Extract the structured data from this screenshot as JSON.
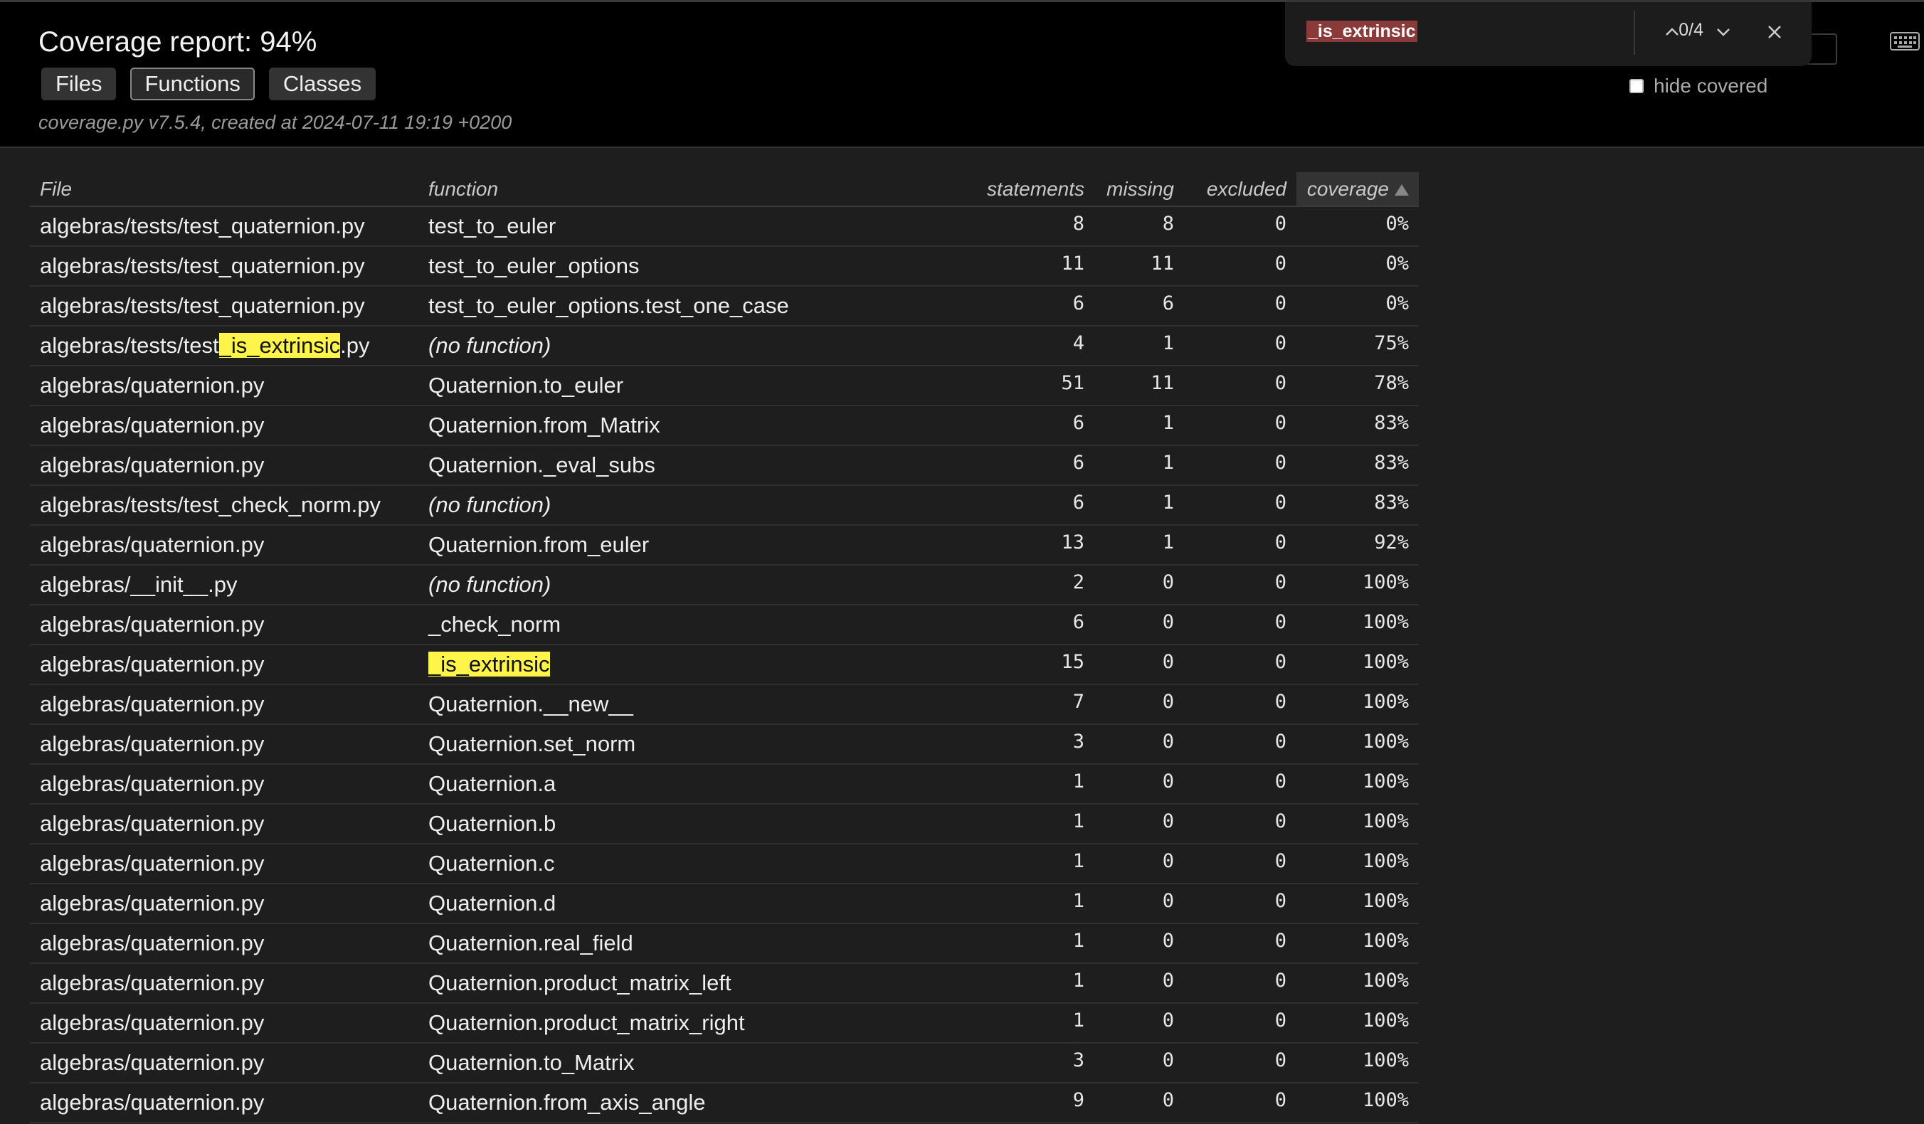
{
  "header": {
    "title": "Coverage report: 94%",
    "tabs": [
      {
        "label": "Files",
        "active": false
      },
      {
        "label": "Functions",
        "active": true
      },
      {
        "label": "Classes",
        "active": false
      }
    ],
    "meta": "coverage.py v7.5.4, created at 2024-07-11 19:19 +0200",
    "hide_covered_label": "hide covered",
    "hide_covered_checked": false
  },
  "find_bar": {
    "query": "_is_extrinsic",
    "count": "0/4",
    "icons": [
      "chevron-up-icon",
      "chevron-down-icon",
      "close-icon"
    ],
    "highlight_color": "#fff44a"
  },
  "table": {
    "columns": [
      "File",
      "function",
      "statements",
      "missing",
      "excluded",
      "coverage"
    ],
    "sorted_column": "coverage",
    "rows": [
      {
        "file": "algebras/tests/test_quaternion.py",
        "function": "test_to_euler",
        "statements": "8",
        "missing": "8",
        "excluded": "0",
        "coverage": "0%"
      },
      {
        "file": "algebras/tests/test_quaternion.py",
        "function": "test_to_euler_options",
        "statements": "11",
        "missing": "11",
        "excluded": "0",
        "coverage": "0%"
      },
      {
        "file": "algebras/tests/test_quaternion.py",
        "function": "test_to_euler_options.test_one_case",
        "statements": "6",
        "missing": "6",
        "excluded": "0",
        "coverage": "0%"
      },
      {
        "file": "algebras/tests/test_is_extrinsic.py",
        "file_parts": [
          "algebras/tests/test",
          "_is_extrinsic",
          ".py"
        ],
        "function": "(no function)",
        "statements": "4",
        "missing": "1",
        "excluded": "0",
        "coverage": "75%"
      },
      {
        "file": "algebras/quaternion.py",
        "function": "Quaternion.to_euler",
        "statements": "51",
        "missing": "11",
        "excluded": "0",
        "coverage": "78%"
      },
      {
        "file": "algebras/quaternion.py",
        "function": "Quaternion.from_Matrix",
        "statements": "6",
        "missing": "1",
        "excluded": "0",
        "coverage": "83%"
      },
      {
        "file": "algebras/quaternion.py",
        "function": "Quaternion._eval_subs",
        "statements": "6",
        "missing": "1",
        "excluded": "0",
        "coverage": "83%"
      },
      {
        "file": "algebras/tests/test_check_norm.py",
        "function": "(no function)",
        "statements": "6",
        "missing": "1",
        "excluded": "0",
        "coverage": "83%"
      },
      {
        "file": "algebras/quaternion.py",
        "function": "Quaternion.from_euler",
        "statements": "13",
        "missing": "1",
        "excluded": "0",
        "coverage": "92%"
      },
      {
        "file": "algebras/__init__.py",
        "function": "(no function)",
        "statements": "2",
        "missing": "0",
        "excluded": "0",
        "coverage": "100%"
      },
      {
        "file": "algebras/quaternion.py",
        "function": "_check_norm",
        "statements": "6",
        "missing": "0",
        "excluded": "0",
        "coverage": "100%"
      },
      {
        "file": "algebras/quaternion.py",
        "function": "_is_extrinsic",
        "function_highlight": true,
        "statements": "15",
        "missing": "0",
        "excluded": "0",
        "coverage": "100%"
      },
      {
        "file": "algebras/quaternion.py",
        "function": "Quaternion.__new__",
        "statements": "7",
        "missing": "0",
        "excluded": "0",
        "coverage": "100%"
      },
      {
        "file": "algebras/quaternion.py",
        "function": "Quaternion.set_norm",
        "statements": "3",
        "missing": "0",
        "excluded": "0",
        "coverage": "100%"
      },
      {
        "file": "algebras/quaternion.py",
        "function": "Quaternion.a",
        "statements": "1",
        "missing": "0",
        "excluded": "0",
        "coverage": "100%"
      },
      {
        "file": "algebras/quaternion.py",
        "function": "Quaternion.b",
        "statements": "1",
        "missing": "0",
        "excluded": "0",
        "coverage": "100%"
      },
      {
        "file": "algebras/quaternion.py",
        "function": "Quaternion.c",
        "statements": "1",
        "missing": "0",
        "excluded": "0",
        "coverage": "100%"
      },
      {
        "file": "algebras/quaternion.py",
        "function": "Quaternion.d",
        "statements": "1",
        "missing": "0",
        "excluded": "0",
        "coverage": "100%"
      },
      {
        "file": "algebras/quaternion.py",
        "function": "Quaternion.real_field",
        "statements": "1",
        "missing": "0",
        "excluded": "0",
        "coverage": "100%"
      },
      {
        "file": "algebras/quaternion.py",
        "function": "Quaternion.product_matrix_left",
        "statements": "1",
        "missing": "0",
        "excluded": "0",
        "coverage": "100%"
      },
      {
        "file": "algebras/quaternion.py",
        "function": "Quaternion.product_matrix_right",
        "statements": "1",
        "missing": "0",
        "excluded": "0",
        "coverage": "100%"
      },
      {
        "file": "algebras/quaternion.py",
        "function": "Quaternion.to_Matrix",
        "statements": "3",
        "missing": "0",
        "excluded": "0",
        "coverage": "100%"
      },
      {
        "file": "algebras/quaternion.py",
        "function": "Quaternion.from_axis_angle",
        "statements": "9",
        "missing": "0",
        "excluded": "0",
        "coverage": "100%"
      }
    ]
  }
}
